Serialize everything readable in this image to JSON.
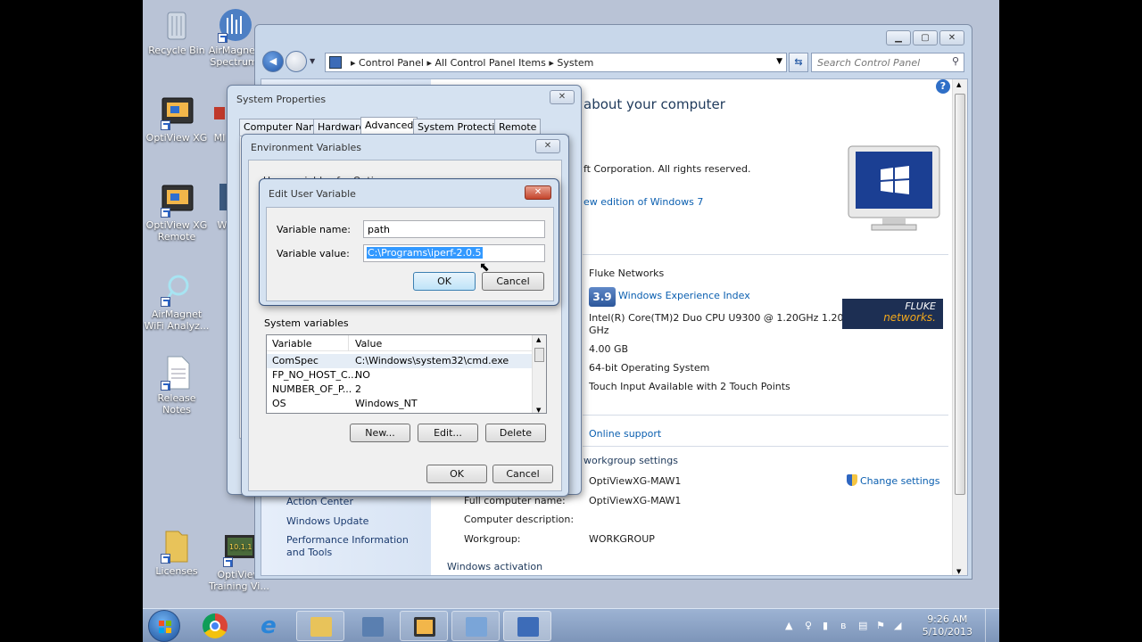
{
  "desktop": {
    "icons": [
      {
        "label": "Recycle Bin"
      },
      {
        "label": "AirMagnet Spectrum"
      },
      {
        "label": "OptiView XG"
      },
      {
        "label": "MI"
      },
      {
        "label": "OptiView XG Remote"
      },
      {
        "label": "W"
      },
      {
        "label": "AirMagnet WiFi Analyz..."
      },
      {
        "label": "Release Notes"
      },
      {
        "label": "Licenses"
      },
      {
        "label": "OptiView Training Vi..."
      }
    ]
  },
  "control_panel": {
    "breadcrumb": [
      "Control Panel",
      "All Control Panel Items",
      "System"
    ],
    "search_placeholder": "Search Control Panel",
    "heading": "about your computer",
    "copyright": "ft Corporation.  All rights reserved.",
    "new_edition_link": "ew edition of Windows 7",
    "manufacturer": "Fluke Networks",
    "rating": "3.9",
    "rating_link": "Windows Experience Index",
    "processor": "Intel(R) Core(TM)2 Duo CPU     U9300  @ 1.20GHz   1.20",
    "processor_2": "GHz",
    "memory": "4.00 GB",
    "system_type": "64-bit Operating System",
    "pen_touch": "Touch Input Available with 2 Touch Points",
    "online_support": "Online support",
    "workgroup_section": "workgroup settings",
    "computer_name_value": "OptiViewXG-MAW1",
    "change_settings": "Change settings",
    "full_name_label": "Full computer name:",
    "full_name_value": "OptiViewXG-MAW1",
    "description_label": "Computer description:",
    "workgroup_label": "Workgroup:",
    "workgroup_value": "WORKGROUP",
    "activation": "Windows activation",
    "left_links": [
      "Action Center",
      "Windows Update",
      "Performance Information and Tools"
    ],
    "fluke_logo_line1": "FLUKE",
    "fluke_logo_line2": "networks."
  },
  "system_properties": {
    "title": "System Properties",
    "tabs": [
      "Computer Name",
      "Hardware",
      "Advanced",
      "System Protection",
      "Remote"
    ],
    "active_tab": "Advanced"
  },
  "env_vars": {
    "title": "Environment Variables",
    "partial_text": "User variables for Opti...",
    "system_label": "System variables",
    "columns": [
      "Variable",
      "Value"
    ],
    "rows": [
      {
        "variable": "ComSpec",
        "value": "C:\\Windows\\system32\\cmd.exe"
      },
      {
        "variable": "FP_NO_HOST_C...",
        "value": "NO"
      },
      {
        "variable": "NUMBER_OF_P...",
        "value": "2"
      },
      {
        "variable": "OS",
        "value": "Windows_NT"
      }
    ],
    "buttons": {
      "new": "New...",
      "edit": "Edit...",
      "delete": "Delete",
      "ok": "OK",
      "cancel": "Cancel"
    }
  },
  "edit_var": {
    "title": "Edit User Variable",
    "name_label": "Variable name:",
    "name_value": "path",
    "value_label": "Variable value:",
    "value_value": "C:\\Programs\\iperf-2.0.5",
    "ok": "OK",
    "cancel": "Cancel"
  },
  "taskbar": {
    "time": "9:26 AM",
    "date": "5/10/2013"
  }
}
